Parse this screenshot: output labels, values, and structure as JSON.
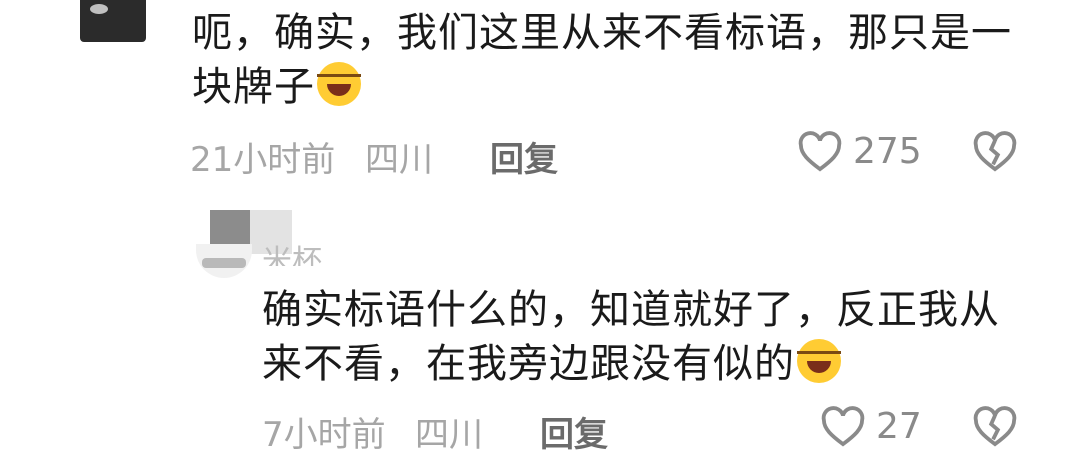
{
  "comments": [
    {
      "text": "呃，确实，我们这里从来不看标语，那只是一块牌子",
      "time": "21小时前",
      "location": "四川",
      "reply_label": "回复",
      "likes": "275",
      "emoji": "face-with-tears-of-joy-emoji"
    },
    {
      "username": "米杯",
      "text": "确实标语什么的，知道就好了，反正我从来不看，在我旁边跟没有似的",
      "time": "7小时前",
      "location": "四川",
      "reply_label": "回复",
      "likes": "27",
      "emoji": "face-with-tears-of-joy-emoji"
    }
  ],
  "colors": {
    "text": "#1a1a1a",
    "meta": "#a6a6a6",
    "reply": "#6b6b6b",
    "icon": "#8a8a8a"
  }
}
